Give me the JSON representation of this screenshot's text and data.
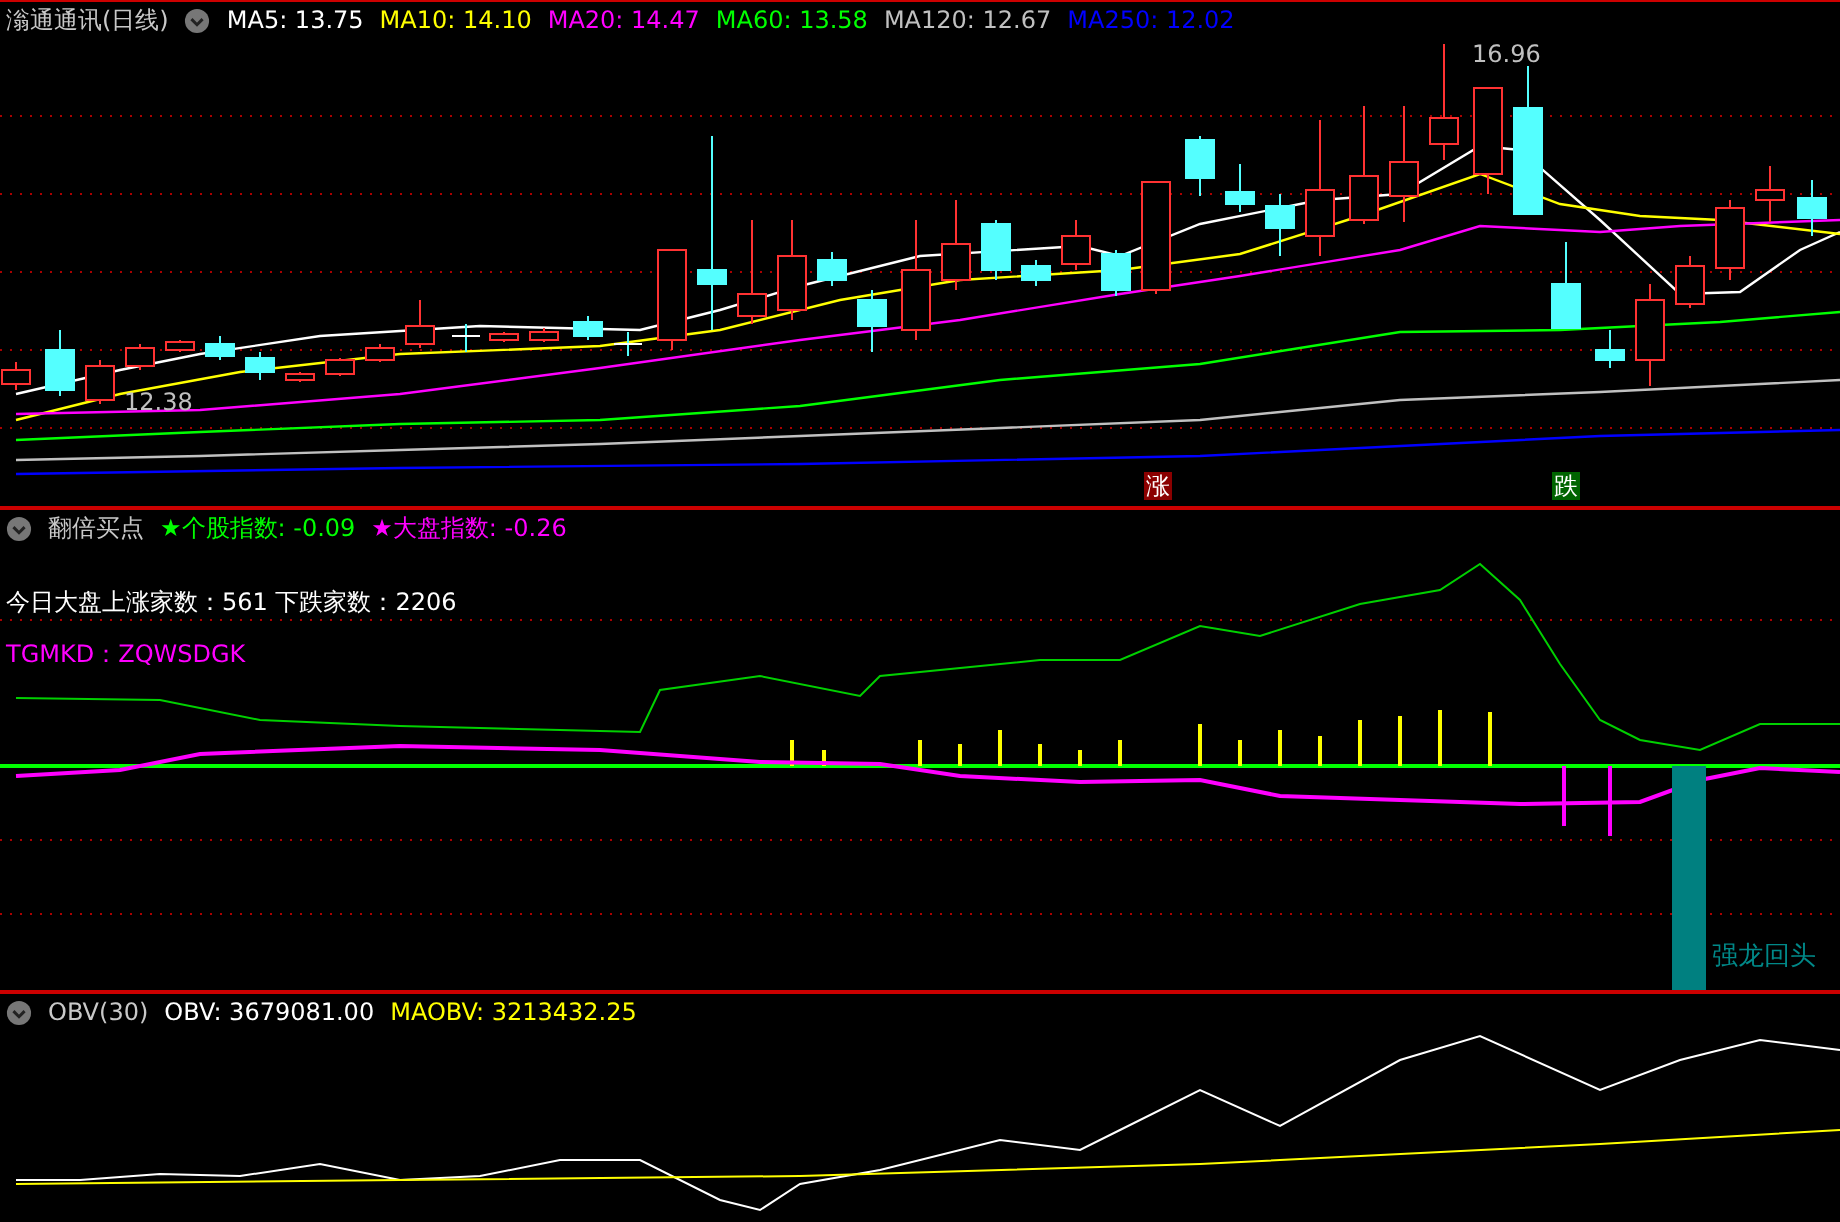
{
  "main_panel": {
    "title": "滃通通讯(日线)",
    "indicators": [
      {
        "label": "MA5: 13.75",
        "color": "#ffffff"
      },
      {
        "label": "MA10: 14.10",
        "color": "#ffff00"
      },
      {
        "label": "MA20: 14.47",
        "color": "#ff00ff"
      },
      {
        "label": "MA60: 13.58",
        "color": "#00ff00"
      },
      {
        "label": "MA120: 12.67",
        "color": "#c0c0c0"
      },
      {
        "label": "MA250: 12.02",
        "color": "#0000ff"
      }
    ],
    "high_label": "16.96",
    "low_label": "12.38",
    "markers": [
      {
        "text": "涨",
        "kind": "rise"
      },
      {
        "text": "跌",
        "kind": "fall"
      }
    ]
  },
  "signal_panel": {
    "title": "翻倍买点",
    "indicators": [
      {
        "label": "★个股指数: -0.09",
        "color": "#00ff00"
      },
      {
        "label": "★大盘指数: -0.26",
        "color": "#ff00ff"
      }
    ],
    "breadth_text": "今日大盘上涨家数：561 下跌家数：2206",
    "formula_text": "TGMKD：ZQWSDGK",
    "signal_label": "强龙回头"
  },
  "obv_panel": {
    "title": "OBV(30)",
    "indicators": [
      {
        "label": "OBV: 3679081.00",
        "color": "#ffffff"
      },
      {
        "label": "MAOBV: 3213432.25",
        "color": "#ffff00"
      }
    ]
  }
}
